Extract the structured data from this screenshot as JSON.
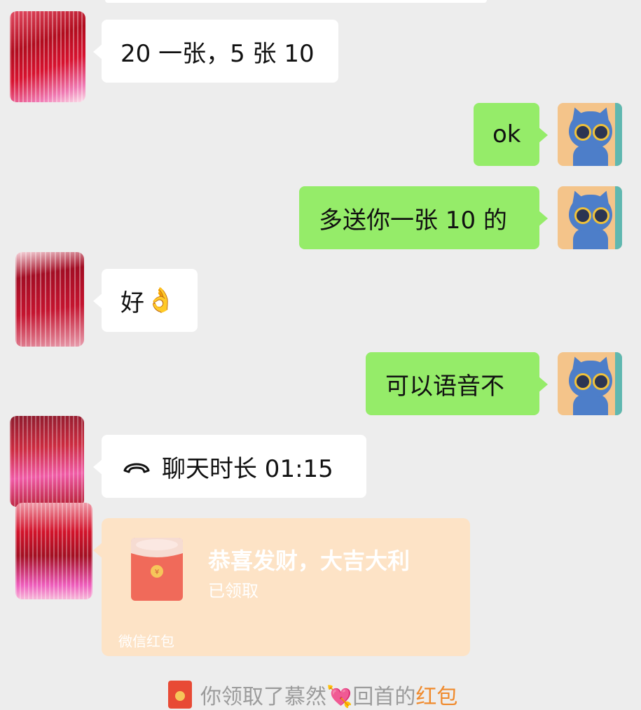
{
  "colors": {
    "background": "#ededed",
    "incoming_bubble": "#ffffff",
    "outgoing_bubble": "#95ec69",
    "red_packet_bg": "#fde3c6",
    "link": "#f08a2c"
  },
  "messages": [
    {
      "side": "incoming",
      "text": "20 一张，5 张 10"
    },
    {
      "side": "outgoing",
      "text": "ok"
    },
    {
      "side": "outgoing",
      "text": "多送你一张 10 的"
    },
    {
      "side": "incoming",
      "text": "好",
      "emoji": "👌"
    },
    {
      "side": "outgoing",
      "text": "可以语音不"
    },
    {
      "side": "incoming",
      "type": "call",
      "icon": "phone-hangup-icon",
      "text": "聊天时长 01:15"
    }
  ],
  "red_packet": {
    "icon": "red-envelope-icon",
    "title": "恭喜发财，大吉大利",
    "status": "已领取",
    "footer": "微信红包"
  },
  "system_notice": {
    "icon": "red-envelope-icon",
    "prefix": "你领取了",
    "name": "慕然💘",
    "suffix": "回首的",
    "link": "红包"
  }
}
